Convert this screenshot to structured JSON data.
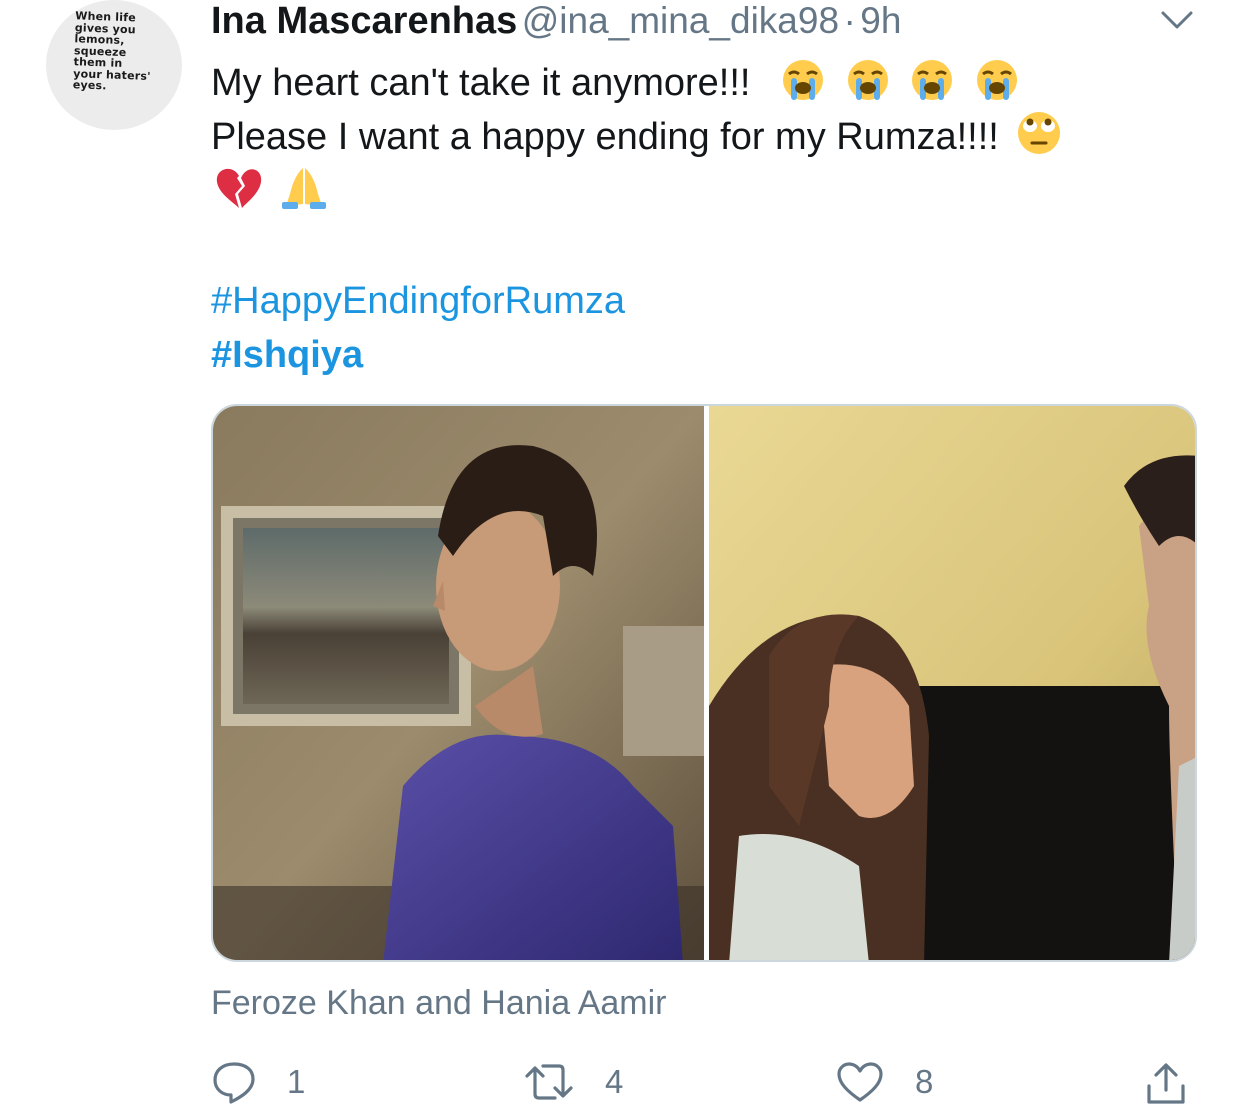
{
  "avatar": {
    "text": "When life\ngives you\nlemons,\nsqueeze\nthem in\nyour haters'\neyes."
  },
  "tweet": {
    "author_name": "Ina Mascarenhas",
    "handle": "@ina_mina_dika98",
    "separator": "·",
    "time": "9h",
    "line1": "My heart can't take it anymore!!!",
    "line2": "Please I want a happy ending for my Rumza!!!!",
    "emojis_line1": [
      "loudly-crying-face",
      "loudly-crying-face",
      "loudly-crying-face",
      "loudly-crying-face"
    ],
    "emojis_line2": [
      "face-with-rolling-eyes"
    ],
    "emojis_line3": [
      "broken-heart",
      "folded-hands"
    ],
    "hashtags": [
      "#HappyEndingforRumza",
      "#Ishqiya"
    ],
    "media_caption": "Feroze Khan and Hania Aamir"
  },
  "actions": {
    "reply_count": "1",
    "retweet_count": "4",
    "like_count": "8"
  },
  "colors": {
    "link": "#1b95e0",
    "secondary_text": "#657786",
    "primary_text": "#14171a",
    "border": "#ccd6dd"
  },
  "icons": [
    "chevron-down-icon",
    "reply-icon",
    "retweet-icon",
    "like-icon",
    "share-icon"
  ]
}
